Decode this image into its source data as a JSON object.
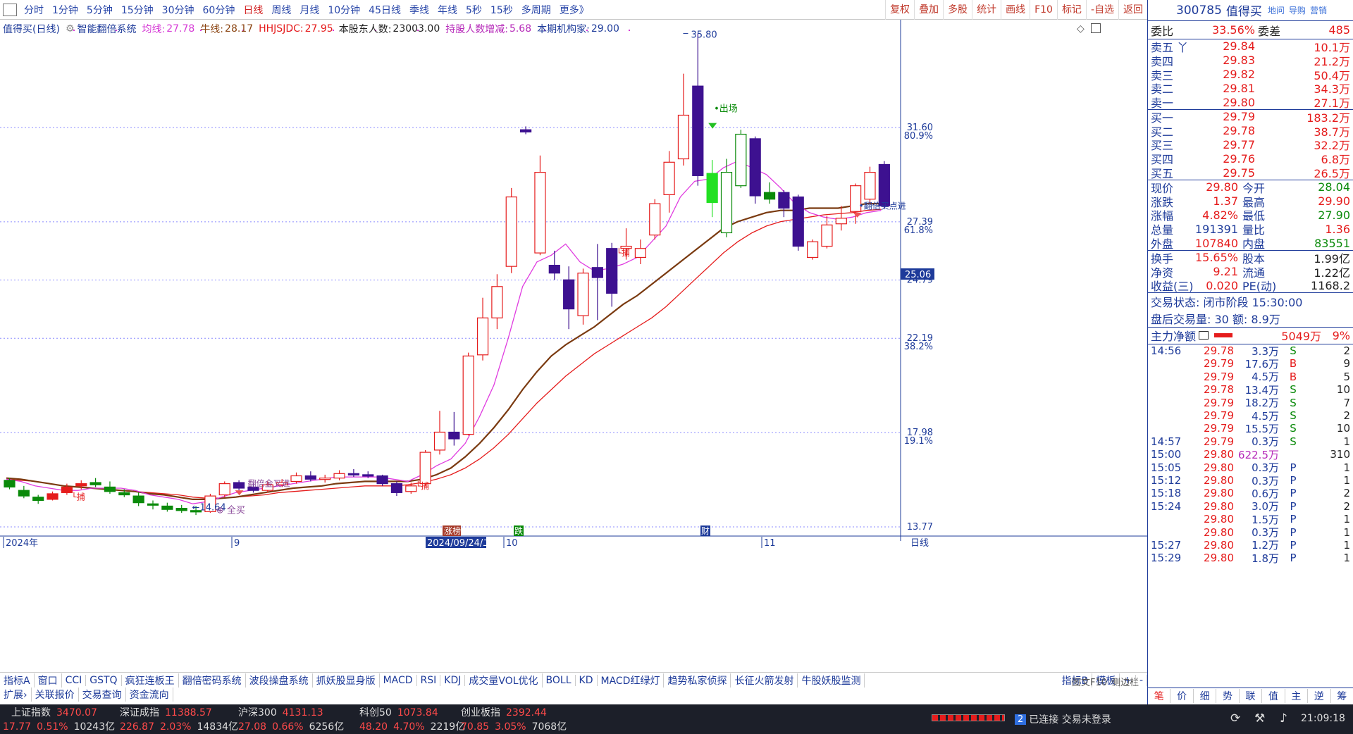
{
  "topbar": {
    "tabs": [
      "分时",
      "1分钟",
      "5分钟",
      "15分钟",
      "30分钟",
      "60分钟",
      "日线",
      "周线",
      "月线",
      "10分钟",
      "45日线",
      "季线",
      "年线",
      "5秒",
      "15秒",
      "多周期",
      "更多》"
    ],
    "active_tab": "日线",
    "right_buttons": [
      "复权",
      "叠加",
      "多股",
      "统计",
      "画线",
      "F10",
      "标记",
      "-自选",
      "返回"
    ]
  },
  "infobar": {
    "stock_name": "值得买(日线)",
    "system": "智能翻倍系统",
    "avg_label": "均线:",
    "avg_value": "27.78",
    "niu_label": "牛线:",
    "niu_value": "28.17",
    "hhj_label": "HHJSJDC:",
    "hhj_value": "27.95",
    "holders_label": "本股东人数:",
    "holders_value": "23003.00",
    "change_label": "持股人数增减:",
    "change_value": "5.68",
    "inst_label": "本期机构家:",
    "inst_value": "29.00"
  },
  "chart_data": {
    "type": "candlestick",
    "title": "值得买(日线)",
    "price_ticks": [
      "31.60",
      "27.39",
      "24.79",
      "22.19",
      "17.98",
      "13.77"
    ],
    "pct_ticks": [
      "80.9%",
      "61.8%",
      "38.2%",
      "19.1%"
    ],
    "price_marker": "25.06",
    "high_annotation": "35.80",
    "low_annotation": "14.64",
    "x_labels": [
      "2024年",
      "9",
      "2024/09/24/二",
      "10",
      "11"
    ],
    "period_label": "日线",
    "annotations": {
      "exit": "出场",
      "buy_point": "翻倍买点进",
      "buy_all": "全买",
      "buy_a": "捕",
      "buy_b": "捕",
      "buy_c": "捕",
      "gold": "翻倍金叉进",
      "limit_up": "涨榜",
      "drop": "跌",
      "fin": "财"
    },
    "candles": [
      {
        "o": 15.85,
        "c": 15.55,
        "h": 15.95,
        "l": 15.45
      },
      {
        "o": 15.4,
        "c": 15.15,
        "h": 15.6,
        "l": 15.05
      },
      {
        "o": 15.1,
        "c": 14.95,
        "h": 15.2,
        "l": 14.8
      },
      {
        "o": 15.0,
        "c": 15.25,
        "h": 15.35,
        "l": 14.95
      },
      {
        "o": 15.3,
        "c": 15.55,
        "h": 15.7,
        "l": 15.2
      },
      {
        "o": 15.6,
        "c": 15.7,
        "h": 15.85,
        "l": 15.45
      },
      {
        "o": 15.75,
        "c": 15.65,
        "h": 15.95,
        "l": 15.55
      },
      {
        "o": 15.55,
        "c": 15.35,
        "h": 15.8,
        "l": 15.25
      },
      {
        "o": 15.3,
        "c": 15.2,
        "h": 15.45,
        "l": 15.1
      },
      {
        "o": 15.15,
        "c": 14.85,
        "h": 15.3,
        "l": 14.7
      },
      {
        "o": 14.8,
        "c": 14.75,
        "h": 14.95,
        "l": 14.55
      },
      {
        "o": 14.7,
        "c": 14.55,
        "h": 14.85,
        "l": 14.45
      },
      {
        "o": 14.6,
        "c": 14.5,
        "h": 14.75,
        "l": 14.4
      },
      {
        "o": 14.5,
        "c": 14.45,
        "h": 14.7,
        "l": 14.3
      },
      {
        "o": 14.45,
        "c": 15.15,
        "h": 15.25,
        "l": 14.4
      },
      {
        "o": 15.2,
        "c": 15.7,
        "h": 15.8,
        "l": 15.1
      },
      {
        "o": 15.75,
        "c": 15.5,
        "h": 15.85,
        "l": 15.4
      },
      {
        "o": 15.55,
        "c": 15.4,
        "h": 15.75,
        "l": 15.3
      },
      {
        "o": 15.4,
        "c": 15.65,
        "h": 15.8,
        "l": 15.3
      },
      {
        "o": 15.65,
        "c": 15.75,
        "h": 15.9,
        "l": 15.55
      },
      {
        "o": 15.8,
        "c": 16.05,
        "h": 16.2,
        "l": 15.7
      },
      {
        "o": 16.05,
        "c": 15.9,
        "h": 16.25,
        "l": 15.8
      },
      {
        "o": 15.9,
        "c": 15.95,
        "h": 16.1,
        "l": 15.75
      },
      {
        "o": 15.95,
        "c": 16.15,
        "h": 16.3,
        "l": 15.85
      },
      {
        "o": 16.15,
        "c": 16.1,
        "h": 16.35,
        "l": 16.0
      },
      {
        "o": 16.1,
        "c": 16.05,
        "h": 16.25,
        "l": 15.95
      },
      {
        "o": 16.05,
        "c": 15.7,
        "h": 16.1,
        "l": 15.6
      },
      {
        "o": 15.7,
        "c": 15.3,
        "h": 15.8,
        "l": 15.15
      },
      {
        "o": 15.35,
        "c": 15.6,
        "h": 15.75,
        "l": 15.25
      },
      {
        "o": 15.7,
        "c": 17.1,
        "h": 17.2,
        "l": 15.6
      },
      {
        "o": 17.2,
        "c": 18.0,
        "h": 18.95,
        "l": 17.0
      },
      {
        "o": 18.0,
        "c": 17.7,
        "h": 18.9,
        "l": 17.4
      },
      {
        "o": 17.9,
        "c": 21.4,
        "h": 21.55,
        "l": 17.85
      },
      {
        "o": 21.45,
        "c": 23.1,
        "h": 24.0,
        "l": 21.2
      },
      {
        "o": 23.1,
        "c": 24.5,
        "h": 25.05,
        "l": 22.6
      },
      {
        "o": 25.4,
        "c": 28.5,
        "h": 28.9,
        "l": 25.1
      },
      {
        "o": 31.5,
        "c": 31.4,
        "h": 31.65,
        "l": 31.3
      },
      {
        "o": 26.0,
        "c": 29.6,
        "h": 30.35,
        "l": 25.9
      },
      {
        "o": 25.45,
        "c": 25.1,
        "h": 26.1,
        "l": 24.8
      },
      {
        "o": 24.8,
        "c": 23.5,
        "h": 25.4,
        "l": 22.6
      },
      {
        "o": 23.2,
        "c": 25.1,
        "h": 25.3,
        "l": 22.8
      },
      {
        "o": 25.35,
        "c": 24.9,
        "h": 26.4,
        "l": 23.0
      },
      {
        "o": 26.2,
        "c": 24.2,
        "h": 26.45,
        "l": 23.6
      },
      {
        "o": 26.2,
        "c": 26.3,
        "h": 27.1,
        "l": 25.7
      },
      {
        "o": 25.8,
        "c": 26.2,
        "h": 26.6,
        "l": 25.5
      },
      {
        "o": 26.8,
        "c": 28.2,
        "h": 28.4,
        "l": 26.6
      },
      {
        "o": 28.6,
        "c": 30.05,
        "h": 30.55,
        "l": 27.8
      },
      {
        "o": 30.2,
        "c": 32.15,
        "h": 34.0,
        "l": 29.9
      },
      {
        "o": 33.45,
        "c": 29.45,
        "h": 35.8,
        "l": 29.0
      },
      {
        "o": 28.25,
        "c": 29.55,
        "h": 30.15,
        "l": 27.6
      },
      {
        "o": 26.9,
        "c": 29.6,
        "h": 30.2,
        "l": 26.7
      },
      {
        "o": 29.0,
        "c": 31.3,
        "h": 31.5,
        "l": 28.9
      },
      {
        "o": 31.1,
        "c": 28.55,
        "h": 31.2,
        "l": 28.2
      },
      {
        "o": 28.7,
        "c": 28.4,
        "h": 29.15,
        "l": 28.2
      },
      {
        "o": 28.7,
        "c": 28.0,
        "h": 28.8,
        "l": 27.6
      },
      {
        "o": 28.5,
        "c": 26.3,
        "h": 28.6,
        "l": 26.1
      },
      {
        "o": 25.8,
        "c": 26.5,
        "h": 26.6,
        "l": 25.7
      },
      {
        "o": 26.3,
        "c": 27.25,
        "h": 27.65,
        "l": 26.2
      },
      {
        "o": 27.3,
        "c": 27.55,
        "h": 28.1,
        "l": 27.0
      },
      {
        "o": 27.85,
        "c": 29.0,
        "h": 29.1,
        "l": 27.3
      },
      {
        "o": 28.4,
        "c": 29.6,
        "h": 29.85,
        "l": 28.2
      },
      {
        "o": 29.95,
        "c": 28.1,
        "h": 30.1,
        "l": 27.95
      }
    ],
    "ma_pink": [
      15.9,
      15.8,
      15.6,
      15.5,
      15.4,
      15.4,
      15.5,
      15.5,
      15.5,
      15.4,
      15.2,
      15.1,
      15.0,
      14.8,
      14.9,
      15.1,
      15.3,
      15.4,
      15.5,
      15.6,
      15.7,
      15.8,
      15.9,
      16.0,
      16.0,
      16.0,
      16.0,
      15.9,
      15.8,
      16.1,
      16.5,
      16.8,
      17.5,
      18.7,
      20.1,
      22.2,
      24.5,
      25.6,
      25.9,
      26.4,
      25.6,
      25.2,
      25.3,
      25.5,
      25.8,
      26.5,
      27.2,
      28.5,
      29.2,
      29.3,
      29.8,
      30.1,
      29.8,
      29.5,
      28.9,
      28.2,
      27.8,
      27.6,
      27.5,
      27.6,
      27.8,
      27.9
    ],
    "ma_brown": [
      15.95,
      15.9,
      15.8,
      15.7,
      15.6,
      15.55,
      15.5,
      15.45,
      15.4,
      15.35,
      15.25,
      15.2,
      15.1,
      15.0,
      15.0,
      15.05,
      15.1,
      15.2,
      15.3,
      15.4,
      15.5,
      15.55,
      15.6,
      15.7,
      15.75,
      15.8,
      15.8,
      15.8,
      15.8,
      15.9,
      16.1,
      16.4,
      16.9,
      17.5,
      18.2,
      19.0,
      19.9,
      20.7,
      21.4,
      21.9,
      22.3,
      22.7,
      23.2,
      23.7,
      24.1,
      24.6,
      25.1,
      25.6,
      26.1,
      26.6,
      27.1,
      27.4,
      27.6,
      27.8,
      27.9,
      27.9,
      28.0,
      28.0,
      28.0,
      28.1,
      28.2,
      28.2
    ],
    "ma_red": [
      15.9,
      15.85,
      15.8,
      15.7,
      15.6,
      15.55,
      15.5,
      15.45,
      15.4,
      15.35,
      15.3,
      15.25,
      15.2,
      15.1,
      15.05,
      15.05,
      15.1,
      15.15,
      15.2,
      15.3,
      15.35,
      15.4,
      15.45,
      15.5,
      15.55,
      15.6,
      15.6,
      15.6,
      15.65,
      15.75,
      15.9,
      16.1,
      16.4,
      16.8,
      17.3,
      17.9,
      18.6,
      19.3,
      19.9,
      20.5,
      21.0,
      21.5,
      21.9,
      22.3,
      22.7,
      23.1,
      23.6,
      24.2,
      24.8,
      25.4,
      26.0,
      26.5,
      26.9,
      27.2,
      27.4,
      27.5,
      27.6,
      27.7,
      27.75,
      27.8,
      27.9,
      27.95
    ]
  },
  "right_panel": {
    "code": "300785",
    "name": "值得买",
    "links": [
      "地问",
      "导购",
      "营销"
    ],
    "weibi_label": "委比",
    "weibi_value": "33.56%",
    "weicha_label": "委差",
    "weicha_value": "485",
    "asks": [
      {
        "label": "卖五 丫",
        "price": "29.84",
        "vol": "10.1万"
      },
      {
        "label": "卖四",
        "price": "29.83",
        "vol": "21.2万"
      },
      {
        "label": "卖三",
        "price": "29.82",
        "vol": "50.4万"
      },
      {
        "label": "卖二",
        "price": "29.81",
        "vol": "34.3万"
      },
      {
        "label": "卖一",
        "price": "29.80",
        "vol": "27.1万"
      }
    ],
    "bids": [
      {
        "label": "买一",
        "price": "29.79",
        "vol": "183.2万"
      },
      {
        "label": "买二",
        "price": "29.78",
        "vol": "38.7万"
      },
      {
        "label": "买三",
        "price": "29.77",
        "vol": "32.2万"
      },
      {
        "label": "买四",
        "price": "29.76",
        "vol": "6.8万"
      },
      {
        "label": "买五",
        "price": "29.75",
        "vol": "26.5万"
      }
    ],
    "quote": [
      {
        "l1": "现价",
        "v1": "29.80",
        "c1": "red",
        "l2": "今开",
        "v2": "28.04",
        "c2": "green"
      },
      {
        "l1": "涨跌",
        "v1": "1.37",
        "c1": "red",
        "l2": "最高",
        "v2": "29.90",
        "c2": "red"
      },
      {
        "l1": "涨幅",
        "v1": "4.82%",
        "c1": "red",
        "l2": "最低",
        "v2": "27.90",
        "c2": "green"
      },
      {
        "l1": "总量",
        "v1": "191391",
        "c1": "blue",
        "l2": "量比",
        "v2": "1.36",
        "c2": "red"
      },
      {
        "l1": "外盘",
        "v1": "107840",
        "c1": "red",
        "l2": "内盘",
        "v2": "83551",
        "c2": "green"
      }
    ],
    "fund": [
      {
        "l1": "换手",
        "v1": "15.65%",
        "l2": "股本",
        "v2": "1.99亿"
      },
      {
        "l1": "净资",
        "v1": "9.21",
        "l2": "流通",
        "v2": "1.22亿"
      },
      {
        "l1": "收益(三)",
        "v1": "0.020",
        "l2": "PE(动)",
        "v2": "1168.2"
      }
    ],
    "trade_status": "交易状态: 闭市阶段 15:30:00",
    "after_hours": "盘后交易量: 30  额: 8.9万",
    "main_label": "主力净额",
    "main_value": "5049万",
    "main_pct": "9%",
    "ticks": [
      {
        "t": "14:56",
        "p": "29.78",
        "v": "3.3万",
        "s": "S",
        "n": "2"
      },
      {
        "t": "",
        "p": "29.79",
        "v": "17.6万",
        "s": "B",
        "n": "9"
      },
      {
        "t": "",
        "p": "29.79",
        "v": "4.5万",
        "s": "B",
        "n": "5"
      },
      {
        "t": "",
        "p": "29.78",
        "v": "13.4万",
        "s": "S",
        "n": "10"
      },
      {
        "t": "",
        "p": "29.79",
        "v": "18.2万",
        "s": "S",
        "n": "7"
      },
      {
        "t": "",
        "p": "29.79",
        "v": "4.5万",
        "s": "S",
        "n": "2"
      },
      {
        "t": "",
        "p": "29.79",
        "v": "15.5万",
        "s": "S",
        "n": "10"
      },
      {
        "t": "14:57",
        "p": "29.79",
        "v": "0.3万",
        "s": "S",
        "n": "1"
      },
      {
        "t": "15:00",
        "p": "29.80",
        "v": "622.5万",
        "s": "",
        "n": "310"
      },
      {
        "t": "15:05",
        "p": "29.80",
        "v": "0.3万",
        "s": "P",
        "n": "1"
      },
      {
        "t": "15:12",
        "p": "29.80",
        "v": "0.3万",
        "s": "P",
        "n": "1"
      },
      {
        "t": "15:18",
        "p": "29.80",
        "v": "0.6万",
        "s": "P",
        "n": "2"
      },
      {
        "t": "15:24",
        "p": "29.80",
        "v": "3.0万",
        "s": "P",
        "n": "2"
      },
      {
        "t": "",
        "p": "29.80",
        "v": "1.5万",
        "s": "P",
        "n": "1"
      },
      {
        "t": "",
        "p": "29.80",
        "v": "0.3万",
        "s": "P",
        "n": "1"
      },
      {
        "t": "15:27",
        "p": "29.80",
        "v": "1.2万",
        "s": "P",
        "n": "1"
      },
      {
        "t": "15:29",
        "p": "29.80",
        "v": "1.8万",
        "s": "P",
        "n": "1"
      }
    ],
    "bottom_tabs": [
      "笔",
      "价",
      "细",
      "势",
      "联",
      "值",
      "主",
      "逆",
      "筹"
    ],
    "side_tabs": "图文F10",
    "side_tabs2": "侧边栏"
  },
  "bottom_tabs": [
    "指标A",
    "窗口",
    "CCI",
    "GSTQ",
    "疯狂连板王",
    "翻倍密码系统",
    "波段操盘系统",
    "抓妖股显身版",
    "MACD",
    "RSI",
    "KDJ",
    "成交量VOL优化",
    "BOLL",
    "KD",
    "MACD红绿灯",
    "趋势私家侦探",
    "长征火箭发射",
    "牛股妖股监测"
  ],
  "bottom_tabs_right": [
    "指标B",
    "模板",
    "+",
    "-"
  ],
  "bottom_tabs2": [
    "扩展›",
    "关联报价",
    "交易查询",
    "资金流向"
  ],
  "status": {
    "indices": [
      {
        "name": "上证指数",
        "value": "3470.07",
        "chg": "17.77",
        "pct": "0.51%",
        "amt": "10243亿"
      },
      {
        "name": "深证成指",
        "value": "11388.57",
        "chg": "226.87",
        "pct": "2.03%",
        "amt": "14834亿"
      },
      {
        "name": "沪深300",
        "value": "4131.13",
        "chg": "27.08",
        "pct": "0.66%",
        "amt": "6256亿"
      },
      {
        "name": "科创50",
        "value": "1073.84",
        "chg": "48.20",
        "pct": "4.70%",
        "amt": "2219亿"
      },
      {
        "name": "创业板指",
        "value": "2392.44",
        "chg": "70.85",
        "pct": "3.05%",
        "amt": "7068亿"
      }
    ],
    "connection": "已连接 交易未登录",
    "connection_num": "2",
    "time": "21:09:18"
  }
}
